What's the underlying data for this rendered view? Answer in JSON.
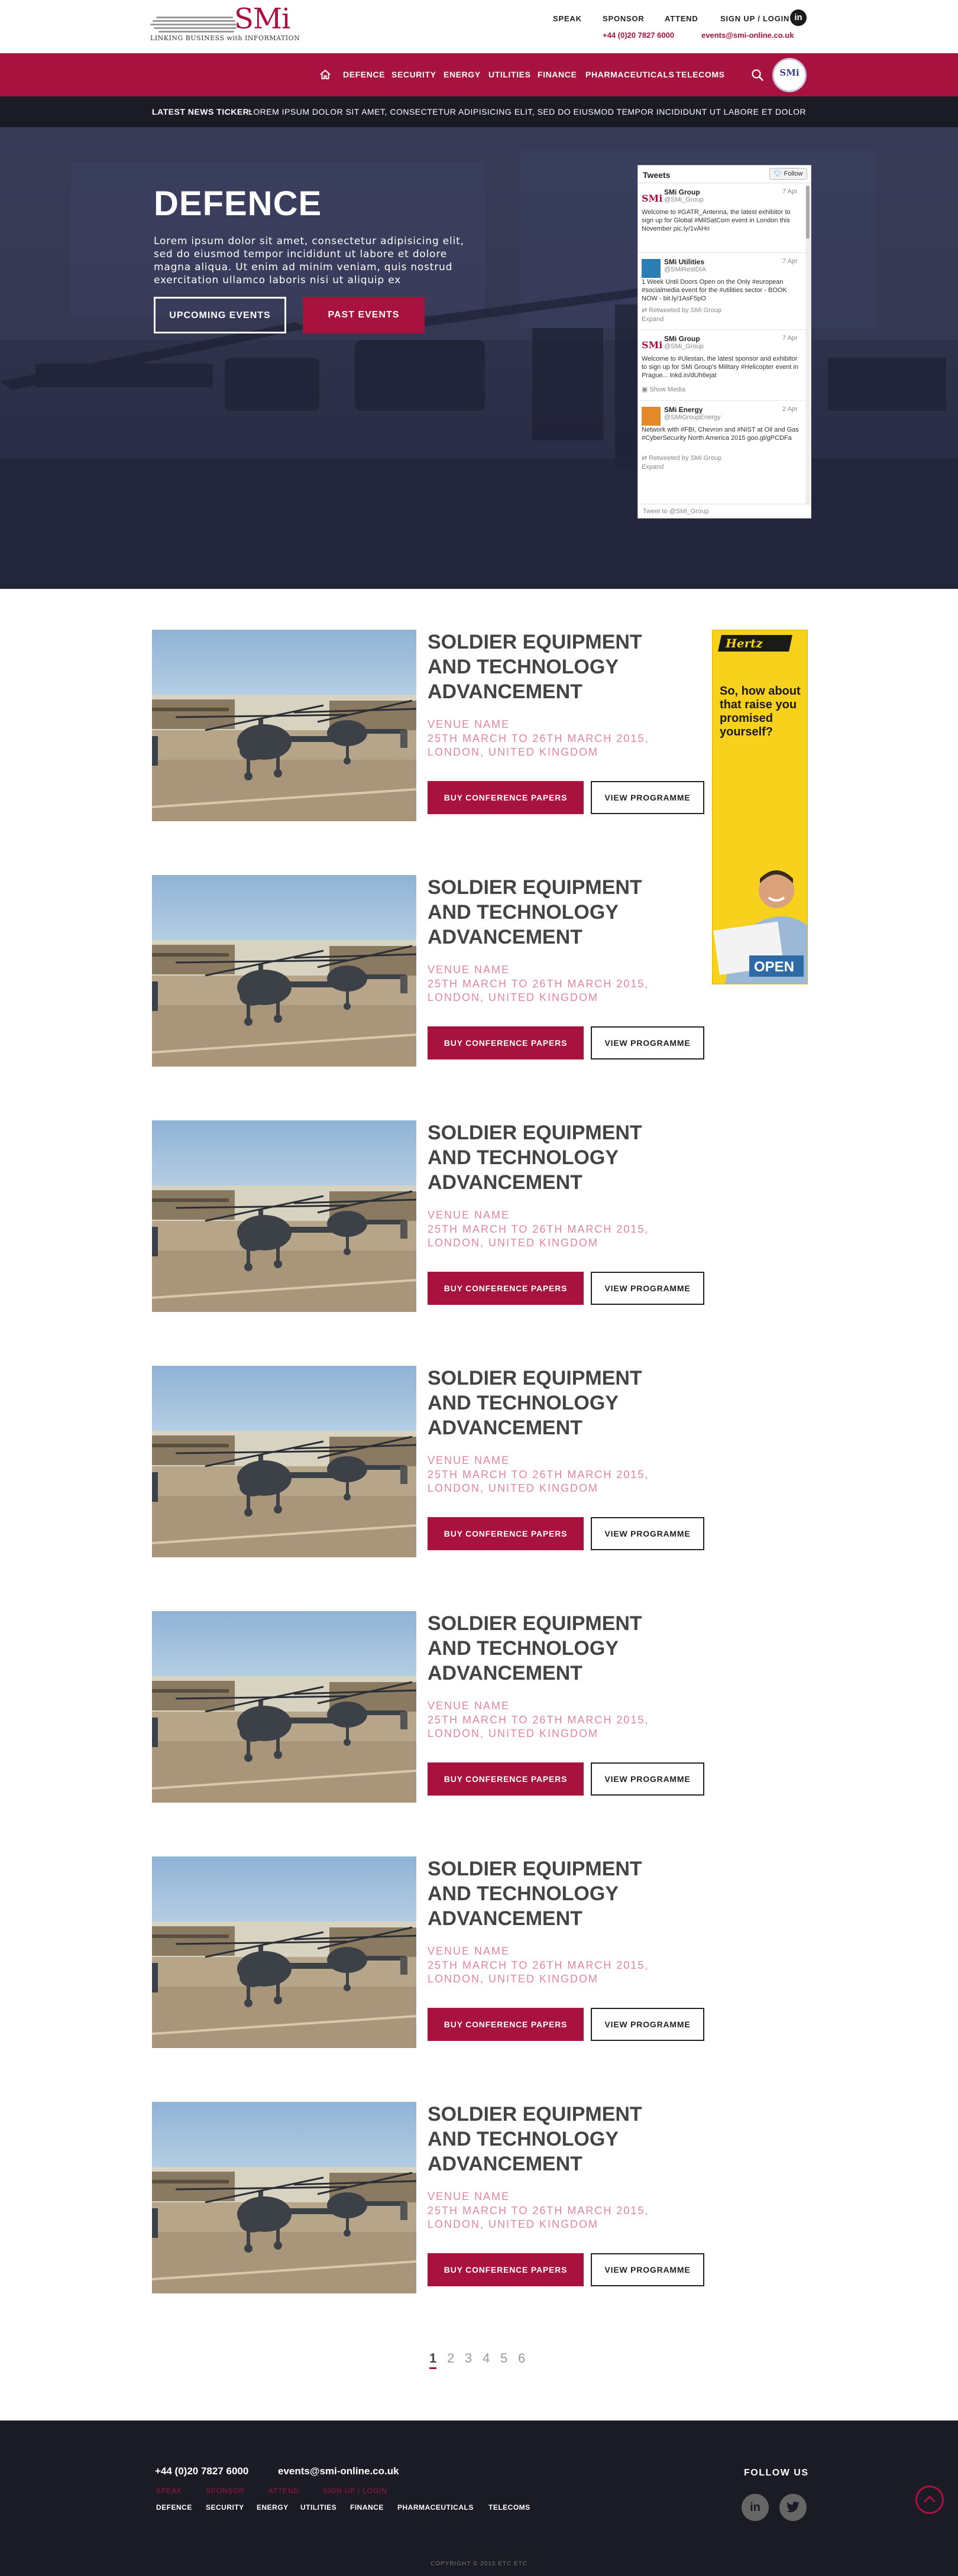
{
  "brand": {
    "logo_text": "SMi",
    "tagline": "LINKING BUSINESS with INFORMATION",
    "primary_color": "#a8123e",
    "dark_color": "#1b1b26"
  },
  "top_nav": {
    "items": [
      "SPEAK",
      "SPONSOR",
      "ATTEND",
      "SIGN UP / LOGIN"
    ],
    "phone": "+44 (0)20 7827 6000",
    "email": "events@smi-online.co.uk",
    "social_icon": "linkedin-icon"
  },
  "main_nav": {
    "home_icon": "home-icon",
    "items": [
      "DEFENCE",
      "SECURITY",
      "ENERGY",
      "UTILITIES",
      "FINANCE",
      "PHARMACEUTICALS",
      "TELECOMS"
    ],
    "search_icon": "search-icon",
    "badge_text": "SMi"
  },
  "ticker": {
    "label": "LATEST NEWS TICKER:",
    "text": "LOREM IPSUM DOLOR SIT AMET, CONSECTETUR ADIPISICING ELIT, SED DO EIUSMOD TEMPOR INCIDIDUNT UT LABORE ET DOLORE MAGNA TO B"
  },
  "hero": {
    "title": "DEFENCE",
    "description": "Lorem ipsum dolor sit amet, consectetur adipisicing elit, sed do eiusmod tempor incididunt ut labore et dolore magna aliqua. Ut enim ad minim veniam, quis nostrud exercitation ullamco laboris nisi ut aliquip ex",
    "btn_upcoming": "UPCOMING EVENTS",
    "btn_past": "PAST EVENTS"
  },
  "tweets_widget": {
    "title": "Tweets",
    "follow_label": "Follow",
    "footer": "Tweet to @SMi_Group",
    "items": [
      {
        "name": "SMi Group",
        "handle": "@SMi_Group",
        "time": "7 Apr",
        "text": "Welcome to #GATR_Antenna, the latest exhibitor to sign up for Global #MilSatCom event in London this November pic.ly/1vAHn",
        "meta": ""
      },
      {
        "name": "SMi Utilities",
        "handle": "@SMiRestDIA",
        "time": "7 Apr",
        "text": "1 Week Until Doors Open on the Only #european #socialmedia event for the #utilities sector - BOOK NOW - bit.ly/1AsF5pO",
        "meta": "Retweeted by SMi Group",
        "meta2": "Expand"
      },
      {
        "name": "SMi Group",
        "handle": "@SMi_Group",
        "time": "7 Apr",
        "text": "Welcome to #Ulestan, the latest sponsor and exhibitor to sign up for SMi Group's Military #Helicopter event in Prague... lnkd.in/dUh6ejat",
        "meta": "Show Media"
      },
      {
        "name": "SMi Energy",
        "handle": "@SMiGroupEnergy",
        "time": "2 Apr",
        "text": "Network with #FBI, Chevron and #NIST at Oil and Gas #CyberSecurity North America 2015 goo.gl/gPCDFa",
        "meta": "Retweeted by SMi Group",
        "meta2": "Expand"
      }
    ]
  },
  "events": [
    {
      "title": "SOLDIER EQUIPMENT AND TECHNOLOGY ADVANCEMENT",
      "venue": "VENUE NAME",
      "dates": "25TH MARCH TO 26TH MARCH 2015, LONDON, UNITED KINGDOM",
      "btn_buy": "BUY CONFERENCE PAPERS",
      "btn_view": "VIEW PROGRAMME"
    },
    {
      "title": "SOLDIER EQUIPMENT AND TECHNOLOGY ADVANCEMENT",
      "venue": "VENUE NAME",
      "dates": "25TH MARCH TO 26TH MARCH 2015, LONDON, UNITED KINGDOM",
      "btn_buy": "BUY CONFERENCE PAPERS",
      "btn_view": "VIEW PROGRAMME"
    },
    {
      "title": "SOLDIER EQUIPMENT AND TECHNOLOGY ADVANCEMENT",
      "venue": "VENUE NAME",
      "dates": "25TH MARCH TO 26TH MARCH 2015, LONDON, UNITED KINGDOM",
      "btn_buy": "BUY CONFERENCE PAPERS",
      "btn_view": "VIEW PROGRAMME"
    },
    {
      "title": "SOLDIER EQUIPMENT AND TECHNOLOGY ADVANCEMENT",
      "venue": "VENUE NAME",
      "dates": "25TH MARCH TO 26TH MARCH 2015, LONDON, UNITED KINGDOM",
      "btn_buy": "BUY CONFERENCE PAPERS",
      "btn_view": "VIEW PROGRAMME"
    },
    {
      "title": "SOLDIER EQUIPMENT AND TECHNOLOGY ADVANCEMENT",
      "venue": "VENUE NAME",
      "dates": "25TH MARCH TO 26TH MARCH 2015, LONDON, UNITED KINGDOM",
      "btn_buy": "BUY CONFERENCE PAPERS",
      "btn_view": "VIEW PROGRAMME"
    },
    {
      "title": "SOLDIER EQUIPMENT AND TECHNOLOGY ADVANCEMENT",
      "venue": "VENUE NAME",
      "dates": "25TH MARCH TO 26TH MARCH 2015, LONDON, UNITED KINGDOM",
      "btn_buy": "BUY CONFERENCE PAPERS",
      "btn_view": "VIEW PROGRAMME"
    },
    {
      "title": "SOLDIER EQUIPMENT AND TECHNOLOGY ADVANCEMENT",
      "venue": "VENUE NAME",
      "dates": "25TH MARCH TO 26TH MARCH 2015, LONDON, UNITED KINGDOM",
      "btn_buy": "BUY CONFERENCE PAPERS",
      "btn_view": "VIEW PROGRAMME"
    }
  ],
  "ad": {
    "brand": "Hertz",
    "text": "So, how about that raise you promised yourself?",
    "sign": "OPEN"
  },
  "pagination": {
    "pages": [
      "1",
      "2",
      "3",
      "4",
      "5",
      "6"
    ],
    "current": "1"
  },
  "footer": {
    "phone": "+44 (0)20 7827 6000",
    "email": "events@smi-online.co.uk",
    "links_top": [
      "SPEAK",
      "SPONSOR",
      "ATTEND",
      "SIGN UP / LOGIN"
    ],
    "links_bottom": [
      "DEFENCE",
      "SECURITY",
      "ENERGY",
      "UTILITIES",
      "FINANCE",
      "PHARMACEUTICALS",
      "TELECOMS"
    ],
    "follow_label": "FOLLOW US",
    "social_icons": [
      "linkedin-icon",
      "twitter-icon"
    ],
    "copyright": "COPYRIGHT © 2015 ETC ETC"
  }
}
